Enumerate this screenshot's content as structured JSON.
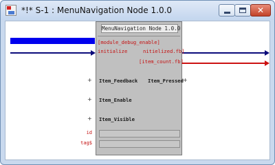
{
  "window": {
    "title": "*!* S-1 : MenuNavigation Node 1.0.0",
    "icons": {
      "app": "app-node-icon",
      "min": "minimize-icon",
      "max": "maximize-icon",
      "close": "close-icon"
    },
    "close_glyph": "✕"
  },
  "node": {
    "title": "MenuNavigation Node 1.0.0",
    "top_left_pin": "[module_debug_enable]",
    "left_inputs": [
      "initialize"
    ],
    "right_outputs": [
      "nitielized.fb]",
      "[item_count.fb]"
    ],
    "left_pins": [
      "Item_Feedback",
      "Item_Enable",
      "Item_Visible"
    ],
    "right_pins": [
      "Item_Pressed"
    ],
    "plus": "+",
    "param_labels": [
      "id",
      "tag$"
    ]
  },
  "colors": {
    "wire_blue": "#0a0a7a",
    "wire_red": "#cc1111",
    "selection": "#0000ee",
    "node_bg": "#c0c0c0"
  }
}
